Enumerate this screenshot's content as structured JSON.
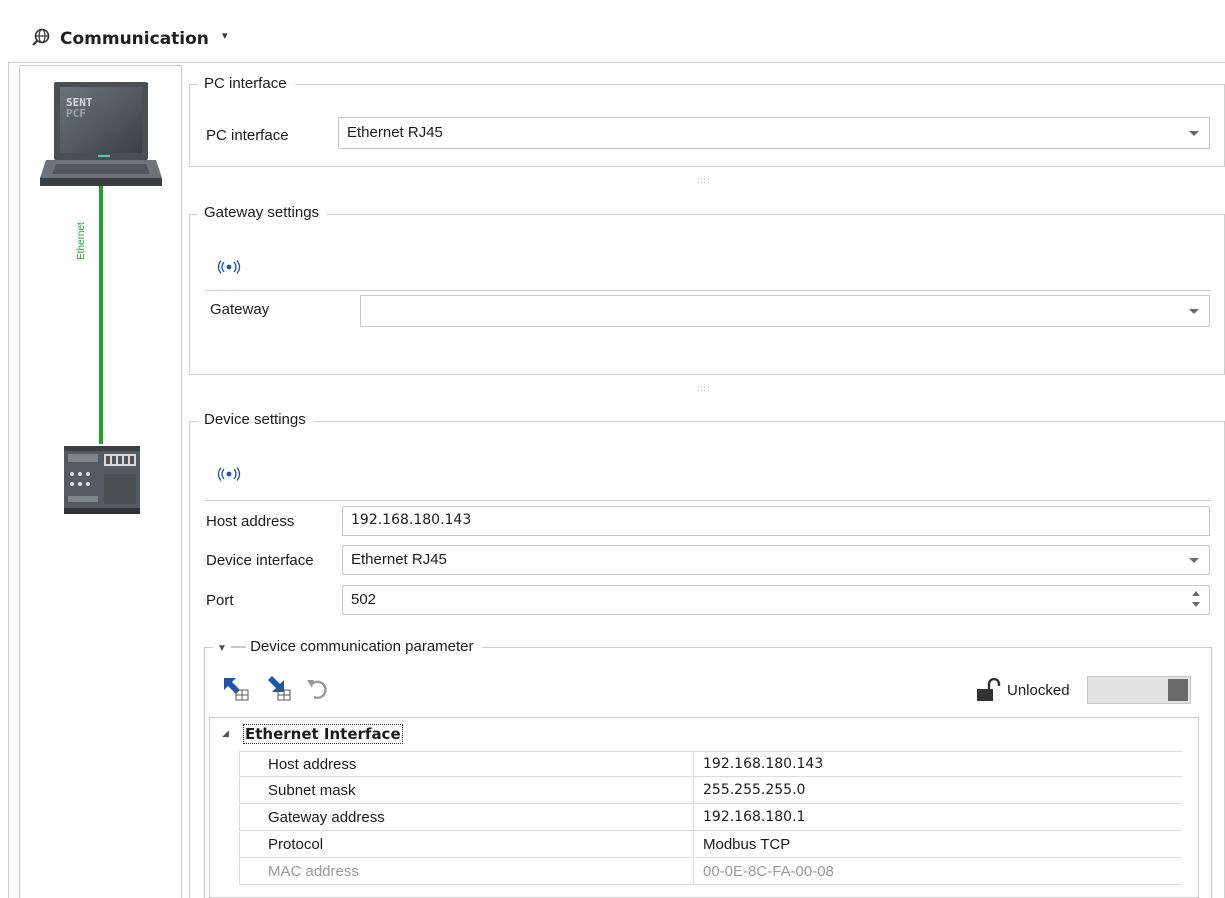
{
  "title": "Communication",
  "left_pane": {
    "pc_label_line1": "SENT",
    "pc_label_line2": "PCF",
    "cable_label": "Ethernet"
  },
  "pc_interface_group": {
    "legend": "PC interface",
    "label": "PC interface",
    "value": "Ethernet RJ45"
  },
  "gateway_group": {
    "legend": "Gateway settings",
    "label": "Gateway",
    "value": ""
  },
  "device_group": {
    "legend": "Device settings",
    "host_label": "Host address",
    "host_value": "192.168.180.143",
    "interface_label": "Device interface",
    "interface_value": "Ethernet RJ45",
    "port_label": "Port",
    "port_value": "502"
  },
  "comm_param": {
    "legend": "Device communication parameter",
    "lock_label": "Unlocked",
    "category": "Ethernet Interface",
    "rows": [
      {
        "name": "Host address",
        "value": "192.168.180.143",
        "disabled": false
      },
      {
        "name": "Subnet mask",
        "value": "255.255.255.0",
        "disabled": false
      },
      {
        "name": "Gateway address",
        "value": "192.168.180.1",
        "disabled": false
      },
      {
        "name": "Protocol",
        "value": "Modbus TCP",
        "disabled": false
      },
      {
        "name": "MAC address",
        "value": "00-0E-8C-FA-00-08",
        "disabled": true
      }
    ]
  },
  "colors": {
    "cable": "#1fa22b",
    "icon_blue": "#1c56a7",
    "border": "#cfcfcf"
  },
  "icons": [
    "communication-icon",
    "chevron-down-icon",
    "wifi-signal-icon",
    "download-to-device-icon",
    "upload-from-device-icon",
    "undo-icon",
    "unlocked-padlock-icon"
  ]
}
